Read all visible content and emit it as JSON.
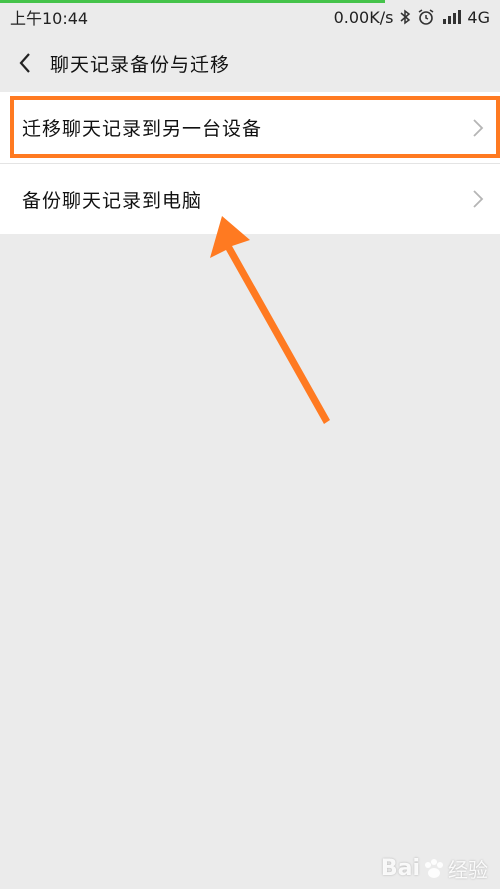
{
  "status": {
    "time": "上午10:44",
    "speed": "0.00K/s",
    "network": "4G",
    "icons": [
      "bluetooth-icon",
      "alarm-icon",
      "signal-icon"
    ]
  },
  "header": {
    "title": "聊天记录备份与迁移"
  },
  "menu": {
    "items": [
      {
        "label": "迁移聊天记录到另一台设备"
      },
      {
        "label": "备份聊天记录到电脑"
      }
    ]
  },
  "watermark": {
    "brand": "Bai",
    "sub": "经验"
  },
  "colors": {
    "background": "#ebebeb",
    "highlight": "#ff7a21",
    "progress": "#45c34a"
  },
  "progress": {
    "fraction": 0.77
  }
}
